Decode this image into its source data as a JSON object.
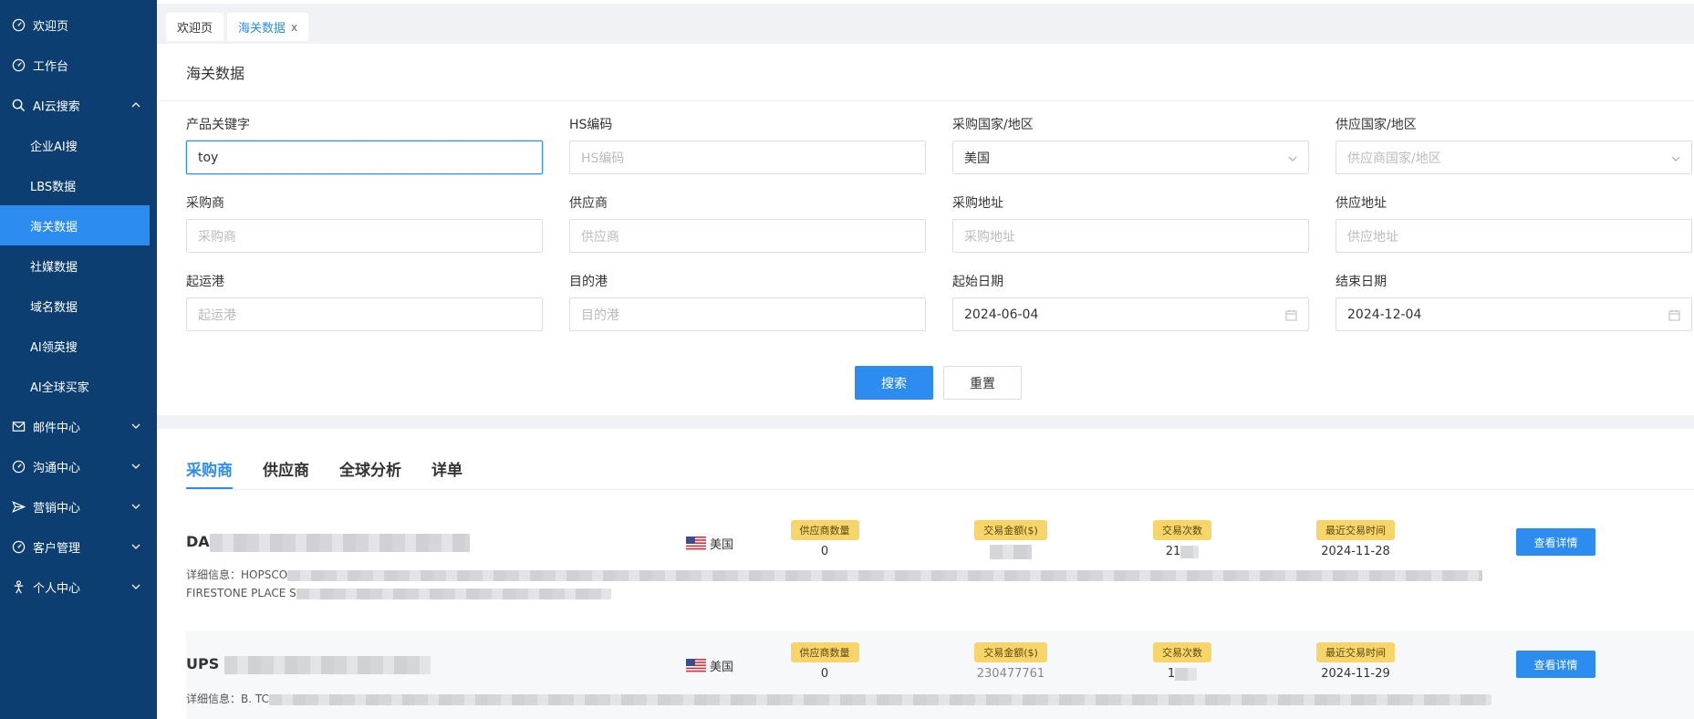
{
  "sidebar": {
    "items": [
      {
        "label": "欢迎页",
        "icon": "dashboard-icon"
      },
      {
        "label": "工作台",
        "icon": "dashboard-icon"
      },
      {
        "label": "AI云搜索",
        "icon": "search-icon"
      }
    ],
    "sub_items": [
      "企业AI搜",
      "LBS数据",
      "海关数据",
      "社媒数据",
      "域名数据",
      "AI领英搜",
      "AI全球买家"
    ],
    "active_sub": "海关数据",
    "groups": [
      {
        "label": "邮件中心",
        "icon": "mail-icon"
      },
      {
        "label": "沟通中心",
        "icon": "dashboard-icon"
      },
      {
        "label": "营销中心",
        "icon": "send-icon"
      },
      {
        "label": "客户管理",
        "icon": "dashboard-icon"
      },
      {
        "label": "个人中心",
        "icon": "person-icon"
      }
    ]
  },
  "tabs": [
    {
      "label": "欢迎页"
    },
    {
      "label": "海关数据",
      "close": "x"
    }
  ],
  "page_title": "海关数据",
  "form": {
    "keyword": {
      "label": "产品关键字",
      "value": "toy"
    },
    "hs_code": {
      "label": "HS编码",
      "placeholder": "HS编码"
    },
    "buyer_country": {
      "label": "采购国家/地区",
      "value": "美国"
    },
    "supplier_country": {
      "label": "供应国家/地区",
      "placeholder": "供应商国家/地区"
    },
    "buyer": {
      "label": "采购商",
      "placeholder": "采购商"
    },
    "supplier": {
      "label": "供应商",
      "placeholder": "供应商"
    },
    "buyer_address": {
      "label": "采购地址",
      "placeholder": "采购地址"
    },
    "supplier_address": {
      "label": "供应地址",
      "placeholder": "供应地址"
    },
    "origin_port": {
      "label": "起运港",
      "placeholder": "起运港"
    },
    "dest_port": {
      "label": "目的港",
      "placeholder": "目的港"
    },
    "start_date": {
      "label": "起始日期",
      "value": "2024-06-04"
    },
    "end_date": {
      "label": "结束日期",
      "value": "2024-12-04"
    },
    "search_label": "搜索",
    "reset_label": "重置"
  },
  "result_tabs": [
    "采购商",
    "供应商",
    "全球分析",
    "详单"
  ],
  "active_result_tab": "采购商",
  "stat_labels": {
    "supplier_count": "供应商数量",
    "trade_amount": "交易金额($)",
    "trade_count": "交易次数",
    "last_trade": "最近交易时间"
  },
  "detail_button": "查看详情",
  "detail_prefix": "详细信息：",
  "results": [
    {
      "name": "DA",
      "country": "美国",
      "supplier_count": "0",
      "trade_amount": "",
      "trade_count": "21",
      "last_trade": "2024-11-28",
      "detail_line1": "HOPSCO",
      "detail_line2": "FIRESTONE PLACE S"
    },
    {
      "name": "UPS",
      "country": "美国",
      "supplier_count": "0",
      "trade_amount": "230477761",
      "trade_count": "1",
      "last_trade": "2024-11-29",
      "detail_line1": "B. TC"
    }
  ]
}
